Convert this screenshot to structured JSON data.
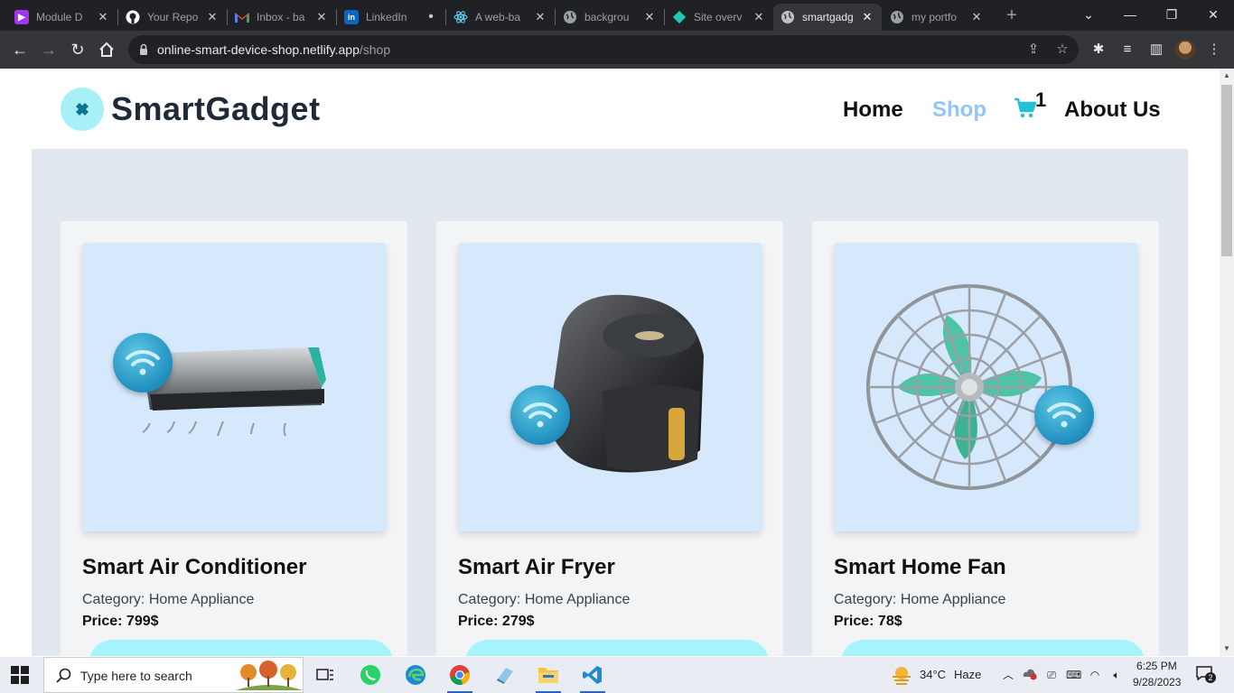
{
  "browser": {
    "tabs": [
      {
        "label": "Module D",
        "favicon": "module-icon",
        "color": "#a335ee"
      },
      {
        "label": "Your Repo",
        "favicon": "github-icon",
        "color": "#ffffff"
      },
      {
        "label": "Inbox - ba",
        "favicon": "gmail-icon",
        "color": "#ea4335"
      },
      {
        "label": "LinkedIn",
        "favicon": "linkedin-icon",
        "color": "#0a66c2"
      },
      {
        "label": "A web-ba",
        "favicon": "react-icon",
        "color": "#61dafb"
      },
      {
        "label": "backgrou",
        "favicon": "globe-icon",
        "color": "#9aa0a6"
      },
      {
        "label": "Site overv",
        "favicon": "netlify-icon",
        "color": "#20c6b7"
      },
      {
        "label": "smartgadg",
        "favicon": "globe-icon",
        "color": "#9aa0a6"
      },
      {
        "label": "my portfo",
        "favicon": "globe-icon",
        "color": "#9aa0a6"
      }
    ],
    "active_tab_index": 7,
    "url_host": "online-smart-device-shop.netlify.app",
    "url_path": "/shop"
  },
  "site": {
    "brand": "SmartGadget",
    "nav": {
      "home": "Home",
      "shop": "Shop",
      "about": "About Us",
      "cart_count": "1"
    },
    "accent_color": "#a5f3fc",
    "active_nav_color": "#93c5fd"
  },
  "products": [
    {
      "title": "Smart Air Conditioner",
      "category_label": "Category:",
      "category": "Home Appliance",
      "price_label": "Price:",
      "price": "799$",
      "image": "air-conditioner-image"
    },
    {
      "title": "Smart Air Fryer",
      "category_label": "Category:",
      "category": "Home Appliance",
      "price_label": "Price:",
      "price": "279$",
      "image": "air-fryer-image"
    },
    {
      "title": "Smart Home Fan",
      "category_label": "Category:",
      "category": "Home Appliance",
      "price_label": "Price:",
      "price": "78$",
      "image": "fan-image"
    }
  ],
  "taskbar": {
    "search_placeholder": "Type here to search",
    "weather_temp": "34°C",
    "weather_text": "Haze",
    "time": "6:25 PM",
    "date": "9/28/2023",
    "notification_count": "2"
  }
}
